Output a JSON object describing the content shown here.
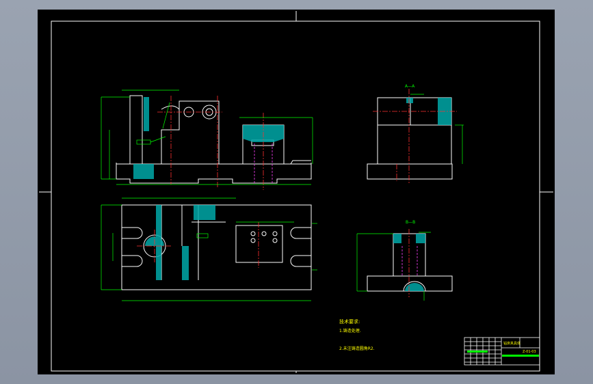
{
  "colors": {
    "background": "#8f98a7",
    "sheet": "#000000",
    "border": "#ffffff",
    "geometry": "#ffffff",
    "dimension": "#00ff00",
    "centerline": "#ff3030",
    "hidden": "#ff40ff",
    "hatch": "#00c8c8",
    "text_yellow": "#ffff00"
  },
  "views": {
    "section_a_label": "A—A",
    "section_b_label": "B—B"
  },
  "notes": {
    "title": "技术要求:",
    "line1": "1.铸造处理.",
    "line2": "2.未注铸造圆角R2."
  },
  "title_block": {
    "part_name": "钻床夹具体",
    "drawing_number": "Z-01-03"
  }
}
